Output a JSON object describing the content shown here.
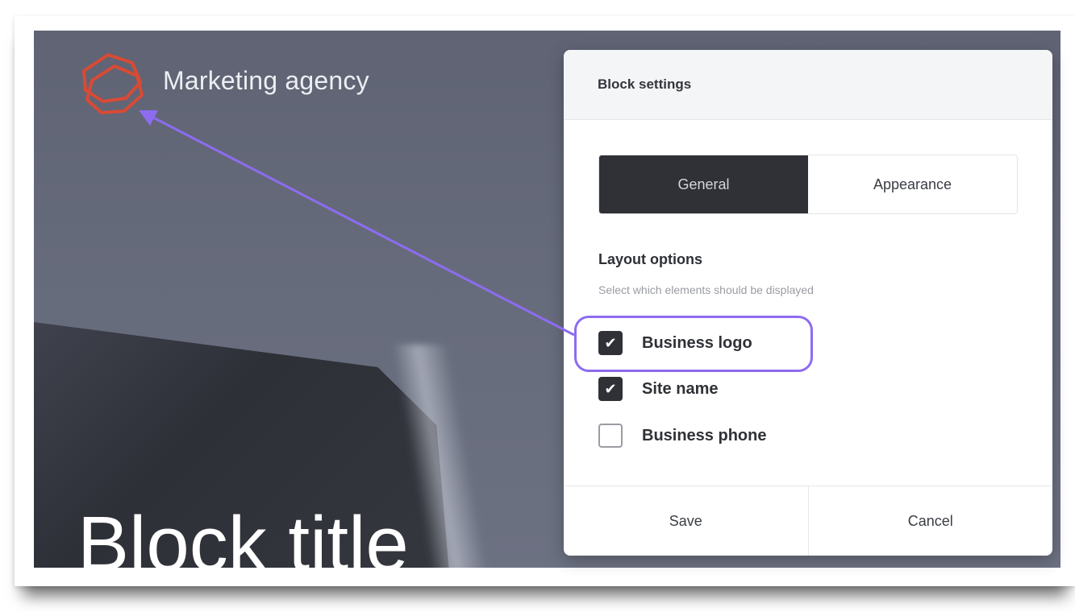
{
  "site": {
    "brand_name": "Marketing agency",
    "block_title": "Block title",
    "logo_icon": "hexagon-logo-icon",
    "logo_color": "#d94a35"
  },
  "panel": {
    "title": "Block settings",
    "tabs": [
      {
        "label": "General",
        "active": true
      },
      {
        "label": "Appearance",
        "active": false
      }
    ],
    "section_title": "Layout options",
    "section_description": "Select which elements should be displayed",
    "options": [
      {
        "label": "Business logo",
        "checked": true
      },
      {
        "label": "Site name",
        "checked": true
      },
      {
        "label": "Business phone",
        "checked": false
      }
    ],
    "save_label": "Save",
    "cancel_label": "Cancel"
  },
  "annotation": {
    "color": "#8d6cf0"
  }
}
